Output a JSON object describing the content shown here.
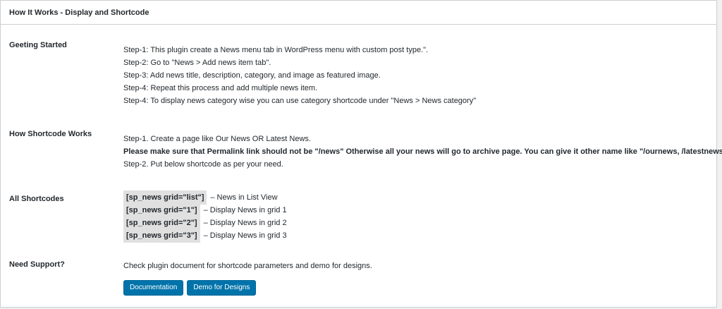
{
  "panel": {
    "title": "How It Works - Display and Shortcode"
  },
  "getting_started": {
    "label": "Geeting Started",
    "steps": [
      "Step-1: This plugin create a News menu tab in WordPress menu with custom post type.\".",
      "Step-2: Go to \"News > Add news item tab\".",
      "Step-3: Add news title, description, category, and image as featured image.",
      "Step-4: Repeat this process and add multiple news item.",
      "Step-4: To display news category wise you can use category shortcode under \"News > News category\""
    ]
  },
  "shortcode_works": {
    "label": "How Shortcode Works",
    "step1": "Step-1. Create a page like Our News OR Latest News.",
    "warning": "Please make sure that Permalink link should not be \"/news\" Otherwise all your news will go to archive page. You can give it other name like \"/ournews, /latestnews etc\"",
    "step2": "Step-2. Put below shortcode as per your need."
  },
  "all_shortcodes": {
    "label": "All Shortcodes",
    "items": [
      {
        "code": "[sp_news grid=\"list\"]",
        "desc": "– News in List View"
      },
      {
        "code": "[sp_news grid=\"1\"]",
        "desc": "– Display News in grid 1"
      },
      {
        "code": "[sp_news grid=\"2\"]",
        "desc": "– Display News in grid 2"
      },
      {
        "code": "[sp_news grid=\"3\"]",
        "desc": "– Display News in grid 3"
      }
    ]
  },
  "support": {
    "label": "Need Support?",
    "text": "Check plugin document for shortcode parameters and demo for designs.",
    "documentation_button": "Documentation",
    "demo_button": "Demo for Designs"
  },
  "colors": {
    "button_primary": "#0073aa",
    "code_background": "#e0e0e0"
  }
}
